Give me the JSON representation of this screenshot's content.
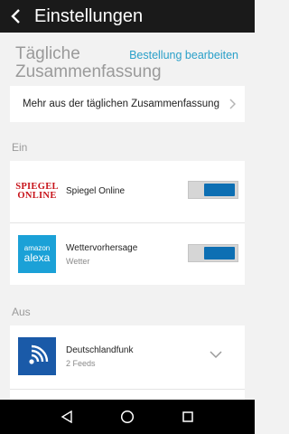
{
  "topbar": {
    "title": "Einstellungen"
  },
  "header": {
    "summary_title": "Tägliche Zusammenfassung",
    "edit_link": "Bestellung bearbeiten"
  },
  "more": {
    "label": "Mehr aus der täglichen Zusammenfassung"
  },
  "sections": {
    "on_label": "Ein",
    "off_label": "Aus"
  },
  "on_items": [
    {
      "logo_text_1": "SPIEGEL",
      "logo_text_2": "ONLINE",
      "name": "Spiegel Online",
      "subtitle": "",
      "enabled": true
    },
    {
      "logo_text_1": "amazon",
      "logo_text_2": "alexa",
      "name": "Wettervorhersage",
      "subtitle": "Wetter",
      "enabled": true
    }
  ],
  "off_items": [
    {
      "name": "Deutschlandfunk",
      "subtitle": "2 Feeds"
    }
  ],
  "icons": {
    "back": "back-arrow-icon",
    "chevron_right": "chevron-right-icon",
    "chevron_down": "chevron-down-icon",
    "nav_back": "nav-back-icon",
    "nav_home": "nav-home-icon",
    "nav_recents": "nav-recents-icon"
  },
  "colors": {
    "accent_link": "#2aa0c9",
    "toggle_on": "#0d6fb3",
    "topbar": "#1a1a1a"
  }
}
